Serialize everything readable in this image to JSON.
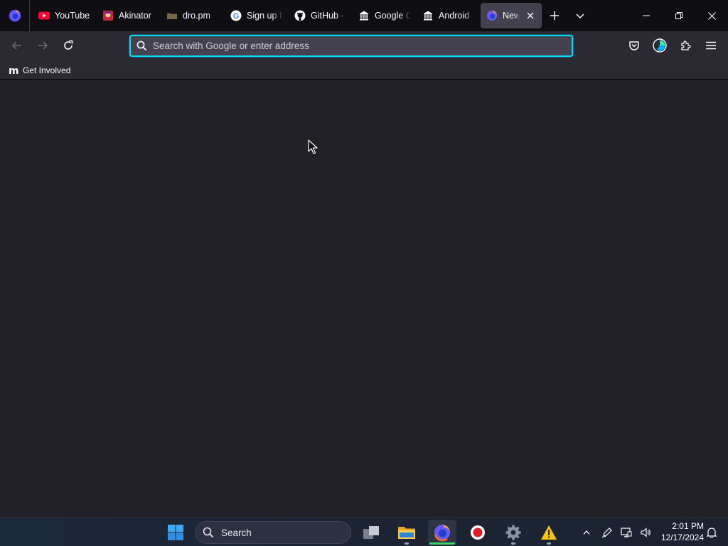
{
  "tabs": [
    {
      "label": "YouTube",
      "icon": "youtube-icon"
    },
    {
      "label": "Akinator",
      "icon": "akinator-icon"
    },
    {
      "label": "dro.pm",
      "icon": "folder-icon"
    },
    {
      "label": "Sign up for",
      "icon": "google-icon"
    },
    {
      "label": "GitHub - ",
      "icon": "github-icon"
    },
    {
      "label": "Google Cl",
      "icon": "library-icon"
    },
    {
      "label": "Android",
      "icon": "library-icon"
    },
    {
      "label": "New Tab",
      "icon": "firefox-icon",
      "active": true
    }
  ],
  "urlbar": {
    "placeholder": "Search with Google or enter address",
    "value": ""
  },
  "bookmarks": [
    {
      "label": "Get Involved",
      "icon": "mozilla-m-icon"
    }
  ],
  "taskbar": {
    "search_label": "Search",
    "time": "2:01 PM",
    "date": "12/17/2024"
  },
  "colors": {
    "accent": "#00ddff",
    "toolbar": "#2b2a33",
    "tabstrip": "#0f0e13",
    "content": "#222127"
  }
}
